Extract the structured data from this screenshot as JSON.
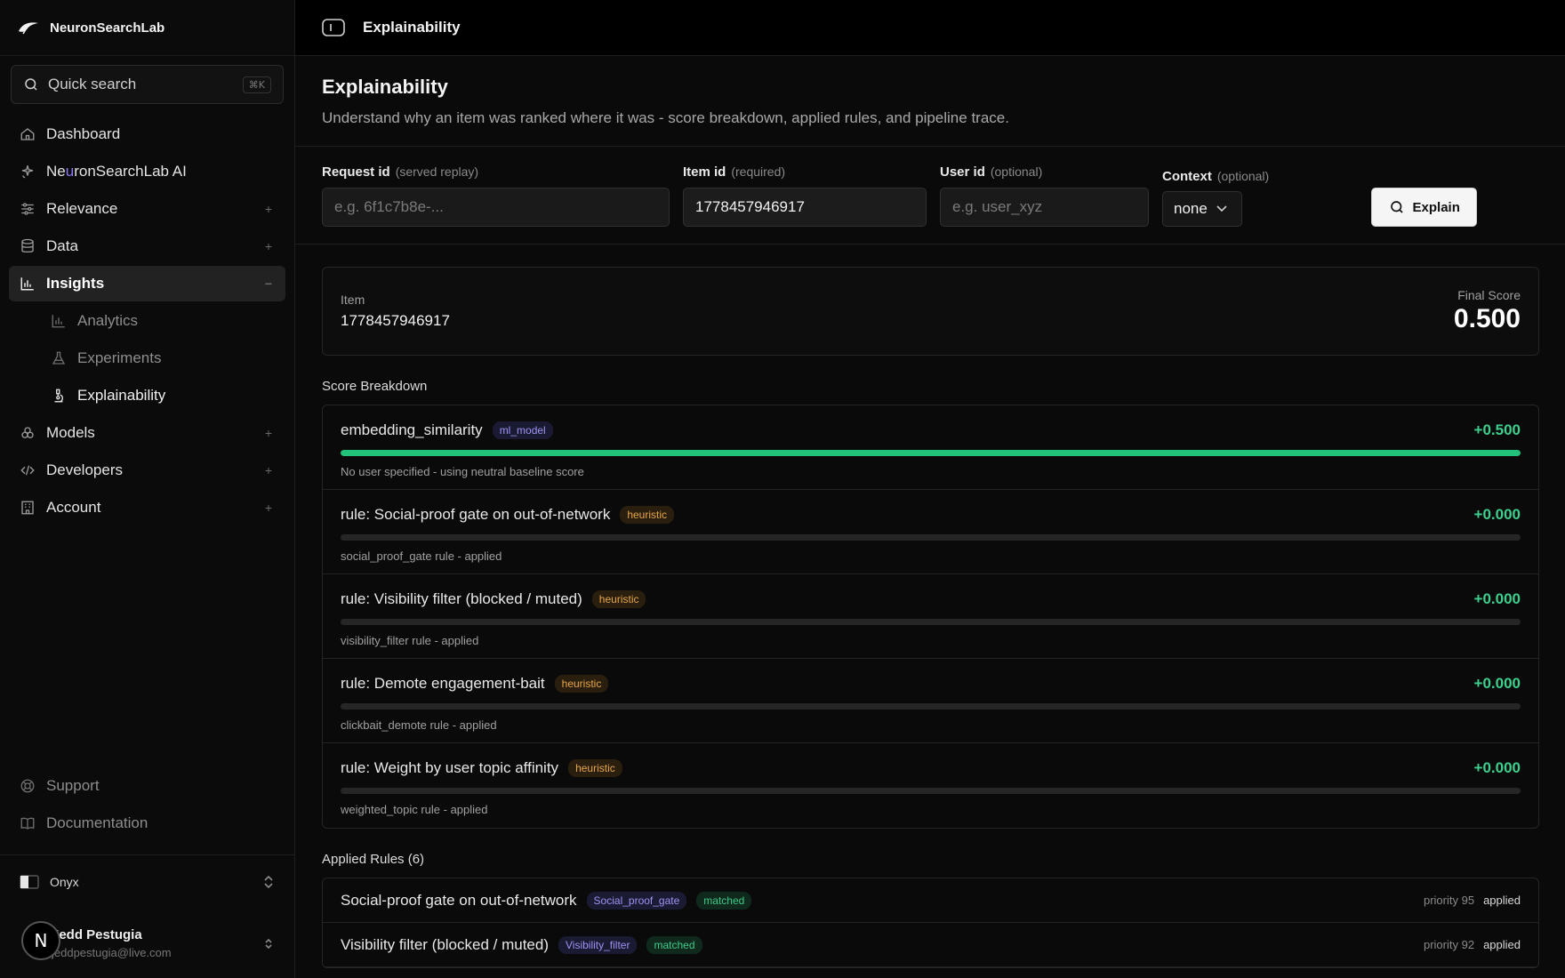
{
  "brand": {
    "name": "NeuronSearchLab"
  },
  "search": {
    "label": "Quick search",
    "shortcut": "⌘K"
  },
  "nav": {
    "dashboard": "Dashboard",
    "ai_prefix": "Ne",
    "ai_highlight": "u",
    "ai_suffix": "ronSearchLab AI",
    "relevance": "Relevance",
    "data": "Data",
    "insights": "Insights",
    "sub": {
      "analytics": "Analytics",
      "experiments": "Experiments",
      "explainability": "Explainability"
    },
    "models": "Models",
    "developers": "Developers",
    "account": "Account",
    "plus": "+",
    "minus": "−"
  },
  "footer": {
    "support": "Support",
    "documentation": "Documentation",
    "workspace": "Onyx",
    "user_name": "Jedd Pestugia",
    "user_email": "jeddpestugia@live.com",
    "avatar_letter": "N"
  },
  "topbar": {
    "title": "Explainability"
  },
  "page": {
    "title": "Explainability",
    "subtitle": "Understand why an item was ranked where it was - score breakdown, applied rules, and pipeline trace."
  },
  "form": {
    "request": {
      "label": "Request id",
      "hint": "(served replay)",
      "placeholder": "e.g. 6f1c7b8e-..."
    },
    "item": {
      "label": "Item id",
      "hint": "(required)",
      "value": "1778457946917"
    },
    "user": {
      "label": "User id",
      "hint": "(optional)",
      "placeholder": "e.g. user_xyz"
    },
    "context": {
      "label": "Context",
      "hint": "(optional)",
      "value": "none"
    },
    "explain_label": "Explain"
  },
  "item_card": {
    "item_label": "Item",
    "item_value": "1778457946917",
    "score_label": "Final Score",
    "score_value": "0.500"
  },
  "breakdown": {
    "title": "Score Breakdown",
    "rows": [
      {
        "name": "embedding_similarity",
        "tag": "ml_model",
        "value": "+0.500",
        "fill": 1.0,
        "note": "No user specified - using neutral baseline score"
      },
      {
        "name": "rule: Social-proof gate on out-of-network",
        "tag": "heuristic",
        "value": "+0.000",
        "fill": 0.0,
        "note": "social_proof_gate rule - applied"
      },
      {
        "name": "rule: Visibility filter (blocked / muted)",
        "tag": "heuristic",
        "value": "+0.000",
        "fill": 0.0,
        "note": "visibility_filter rule - applied"
      },
      {
        "name": "rule: Demote engagement-bait",
        "tag": "heuristic",
        "value": "+0.000",
        "fill": 0.0,
        "note": "clickbait_demote rule - applied"
      },
      {
        "name": "rule: Weight by user topic affinity",
        "tag": "heuristic",
        "value": "+0.000",
        "fill": 0.0,
        "note": "weighted_topic rule - applied"
      }
    ]
  },
  "applied_rules": {
    "title": "Applied Rules (6)",
    "rows": [
      {
        "name": "Social-proof gate on out-of-network",
        "rule": "Social_proof_gate",
        "status": "matched",
        "priority": "priority 95",
        "state": "applied"
      },
      {
        "name": "Visibility filter (blocked / muted)",
        "rule": "Visibility_filter",
        "status": "matched",
        "priority": "priority 92",
        "state": "applied"
      }
    ]
  },
  "colors": {
    "accent_green": "#22c27a",
    "positive_text": "#3ecf8e",
    "ml_tag": "#9d94f3",
    "heuristic_tag": "#e6a54a"
  }
}
